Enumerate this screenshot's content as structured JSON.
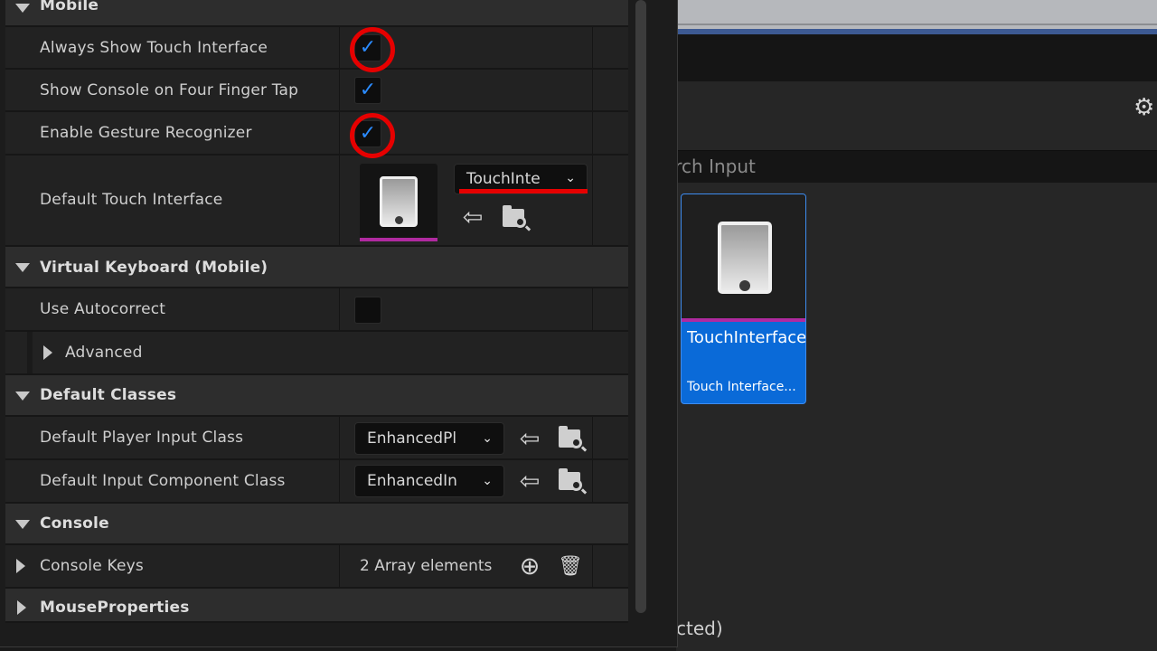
{
  "content_browser": {
    "search_placeholder": "arch Input",
    "asset": {
      "name": "TouchInterface",
      "type": "Touch Interface..."
    },
    "status_text": "cted)"
  },
  "details": {
    "mobile": {
      "header": "Mobile",
      "always_show_touch_interface": {
        "label": "Always Show Touch Interface",
        "checked": true
      },
      "show_console_four_finger": {
        "label": "Show Console on Four Finger Tap",
        "checked": true
      },
      "enable_gesture_recognizer": {
        "label": "Enable Gesture Recognizer",
        "checked": true
      },
      "default_touch_interface": {
        "label": "Default Touch Interface",
        "value": "TouchInte"
      }
    },
    "virtual_keyboard": {
      "header": "Virtual Keyboard (Mobile)",
      "use_autocorrect": {
        "label": "Use Autocorrect",
        "checked": false
      },
      "advanced": "Advanced"
    },
    "default_classes": {
      "header": "Default Classes",
      "player_input_class": {
        "label": "Default Player Input Class",
        "value": "EnhancedPl"
      },
      "input_component_class": {
        "label": "Default Input Component Class",
        "value": "EnhancedIn"
      }
    },
    "console": {
      "header": "Console",
      "console_keys": {
        "label": "Console Keys",
        "value": "2 Array elements"
      }
    },
    "mouse_properties": {
      "header": "MouseProperties"
    }
  },
  "icons": {
    "check": "✓",
    "chevron": "⌄",
    "use_selected": "⇦",
    "add": "⊕",
    "trash": "🗑",
    "gear": "⚙"
  },
  "colors": {
    "accent_blue": "#0a6ad8",
    "check_blue": "#2b8bff",
    "highlight_red": "#e60000",
    "asset_type_line": "#b02aa0"
  }
}
